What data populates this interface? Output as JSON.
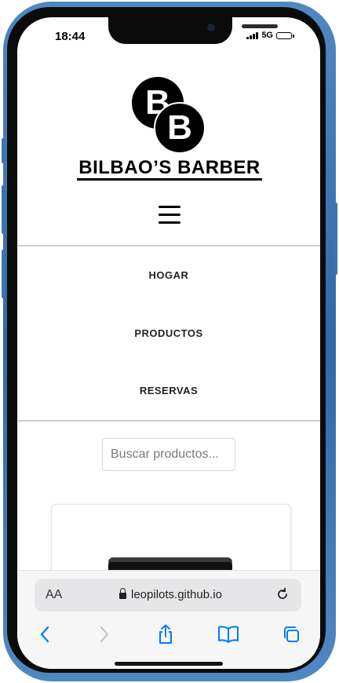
{
  "status_bar": {
    "time": "18:44",
    "network": "5G"
  },
  "site": {
    "logo_letter_top": "B",
    "logo_letter_bottom": "B",
    "brand_name": "BILBAO’S BARBER"
  },
  "nav": {
    "menu_icon": "hamburger-menu-icon",
    "items": [
      {
        "label": "HOGAR"
      },
      {
        "label": "PRODUCTOS"
      },
      {
        "label": "RESERVAS"
      }
    ]
  },
  "search": {
    "placeholder": "Buscar productos..."
  },
  "browser": {
    "text_size_label": "AA",
    "url": "leopilots.github.io",
    "toolbar_icons": [
      "back-icon",
      "forward-icon",
      "share-icon",
      "bookmarks-icon",
      "tabs-icon"
    ]
  },
  "colors": {
    "accent": "#007aff",
    "frame": "#3d74b0",
    "text": "#222222"
  }
}
